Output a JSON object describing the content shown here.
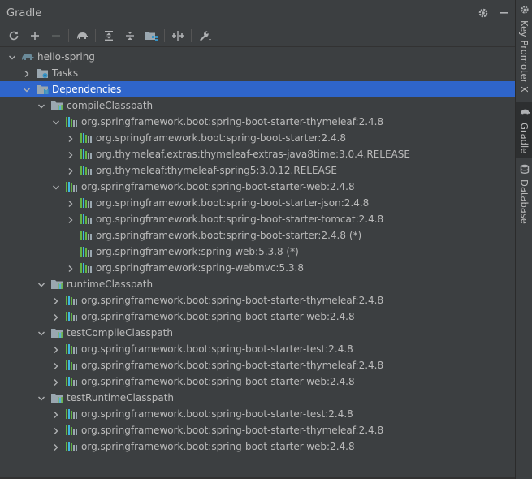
{
  "panel": {
    "title": "Gradle"
  },
  "right_tabs": [
    {
      "label": "Key Promoter X",
      "icon": "gear-icon"
    },
    {
      "label": "Gradle",
      "icon": "elephant-icon"
    },
    {
      "label": "Database",
      "icon": "database-icon"
    }
  ],
  "toolbar": {
    "buttons": [
      "reload-icon",
      "add-icon",
      "remove-icon",
      "execute-task-icon",
      "expand-all-icon",
      "collapse-all-icon",
      "group-modules-icon",
      "toggle-offline-icon",
      "settings-wrench-icon"
    ]
  },
  "tree": [
    {
      "label": "hello-spring",
      "level": 0,
      "expanded": true,
      "icon": "gradle-project-icon"
    },
    {
      "label": "Tasks",
      "level": 1,
      "expanded": false,
      "icon": "tasks-folder-icon"
    },
    {
      "label": "Dependencies",
      "level": 1,
      "expanded": true,
      "icon": "dependencies-folder-icon",
      "selected": true
    },
    {
      "label": "compileClasspath",
      "level": 2,
      "expanded": true,
      "icon": "configuration-icon"
    },
    {
      "label": "org.springframework.boot:spring-boot-starter-thymeleaf:2.4.8",
      "level": 3,
      "expanded": true,
      "icon": "library-icon"
    },
    {
      "label": "org.springframework.boot:spring-boot-starter:2.4.8",
      "level": 4,
      "expanded": false,
      "icon": "library-icon"
    },
    {
      "label": "org.thymeleaf.extras:thymeleaf-extras-java8time:3.0.4.RELEASE",
      "level": 4,
      "expanded": false,
      "icon": "library-icon"
    },
    {
      "label": "org.thymeleaf:thymeleaf-spring5:3.0.12.RELEASE",
      "level": 4,
      "expanded": false,
      "icon": "library-icon"
    },
    {
      "label": "org.springframework.boot:spring-boot-starter-web:2.4.8",
      "level": 3,
      "expanded": true,
      "icon": "library-icon"
    },
    {
      "label": "org.springframework.boot:spring-boot-starter-json:2.4.8",
      "level": 4,
      "expanded": false,
      "icon": "library-icon"
    },
    {
      "label": "org.springframework.boot:spring-boot-starter-tomcat:2.4.8",
      "level": 4,
      "expanded": false,
      "icon": "library-icon"
    },
    {
      "label": "org.springframework.boot:spring-boot-starter:2.4.8 (*)",
      "level": 4,
      "expanded": null,
      "icon": "library-icon"
    },
    {
      "label": "org.springframework:spring-web:5.3.8 (*)",
      "level": 4,
      "expanded": null,
      "icon": "library-icon"
    },
    {
      "label": "org.springframework:spring-webmvc:5.3.8",
      "level": 4,
      "expanded": false,
      "icon": "library-icon"
    },
    {
      "label": "runtimeClasspath",
      "level": 2,
      "expanded": true,
      "icon": "configuration-icon"
    },
    {
      "label": "org.springframework.boot:spring-boot-starter-thymeleaf:2.4.8",
      "level": 3,
      "expanded": false,
      "icon": "library-icon"
    },
    {
      "label": "org.springframework.boot:spring-boot-starter-web:2.4.8",
      "level": 3,
      "expanded": false,
      "icon": "library-icon"
    },
    {
      "label": "testCompileClasspath",
      "level": 2,
      "expanded": true,
      "icon": "configuration-icon"
    },
    {
      "label": "org.springframework.boot:spring-boot-starter-test:2.4.8",
      "level": 3,
      "expanded": false,
      "icon": "library-icon"
    },
    {
      "label": "org.springframework.boot:spring-boot-starter-thymeleaf:2.4.8",
      "level": 3,
      "expanded": false,
      "icon": "library-icon"
    },
    {
      "label": "org.springframework.boot:spring-boot-starter-web:2.4.8",
      "level": 3,
      "expanded": false,
      "icon": "library-icon"
    },
    {
      "label": "testRuntimeClasspath",
      "level": 2,
      "expanded": true,
      "icon": "configuration-icon"
    },
    {
      "label": "org.springframework.boot:spring-boot-starter-test:2.4.8",
      "level": 3,
      "expanded": false,
      "icon": "library-icon"
    },
    {
      "label": "org.springframework.boot:spring-boot-starter-thymeleaf:2.4.8",
      "level": 3,
      "expanded": false,
      "icon": "library-icon"
    },
    {
      "label": "org.springframework.boot:spring-boot-starter-web:2.4.8",
      "level": 3,
      "expanded": false,
      "icon": "library-icon"
    }
  ],
  "colors": {
    "background": "#3c3f41",
    "selection": "#2f65ca",
    "text": "#bbbbbb",
    "library_green": "#62b543",
    "library_blue": "#40b6e0",
    "folder": "#9aa7b0"
  }
}
